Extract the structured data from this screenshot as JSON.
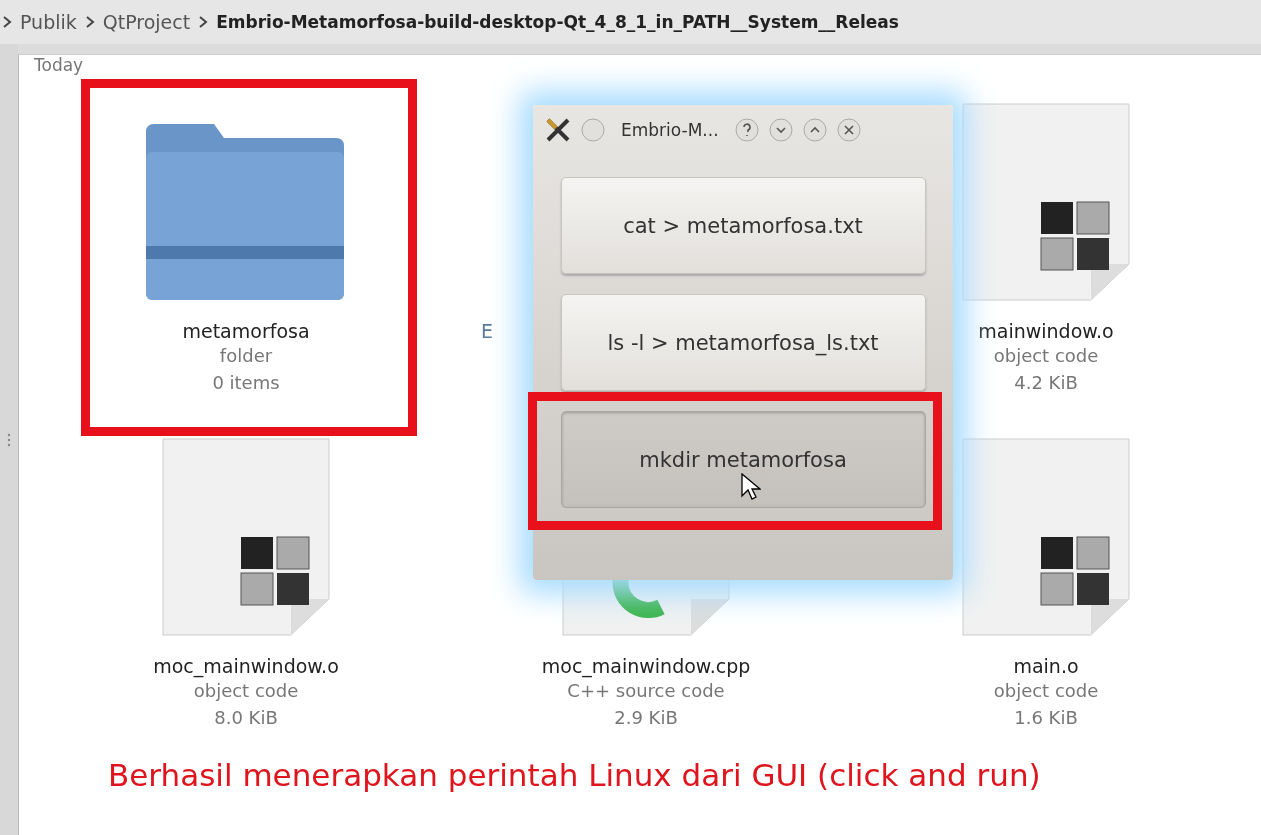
{
  "breadcrumb": [
    {
      "label": "Publik",
      "current": false
    },
    {
      "label": "QtProject",
      "current": false
    },
    {
      "label": "Embrio-Metamorfosa-build-desktop-Qt_4_8_1_in_PATH__System__Releas",
      "current": true
    }
  ],
  "group_label": "Today",
  "files": [
    {
      "kind": "folder",
      "name": "metamorfosa",
      "type": "folder",
      "size": "0 items",
      "highlighted": true
    },
    {
      "kind": "covered",
      "name": "E",
      "highlighted": false
    },
    {
      "kind": "object",
      "name": "mainwindow.o",
      "type": "object code",
      "size": "4.2 KiB",
      "highlighted": false
    },
    {
      "kind": "object",
      "name": "moc_mainwindow.o",
      "type": "object code",
      "size": "8.0 KiB",
      "highlighted": false
    },
    {
      "kind": "cpp",
      "name": "moc_mainwindow.cpp",
      "type": "C++ source code",
      "size": "2.9 KiB",
      "highlighted": false
    },
    {
      "kind": "object",
      "name": "main.o",
      "type": "object code",
      "size": "1.6 KiB",
      "highlighted": false
    }
  ],
  "dialog": {
    "title": "Embrio-M...",
    "buttons": [
      {
        "label": "cat > metamorfosa.txt",
        "pressed": false,
        "highlighted": false
      },
      {
        "label": "ls -l > metamorfosa_ls.txt",
        "pressed": false,
        "highlighted": false
      },
      {
        "label": "mkdir metamorfosa",
        "pressed": true,
        "highlighted": true
      }
    ]
  },
  "caption": "Berhasil menerapkan perintah Linux dari GUI (click and run)"
}
